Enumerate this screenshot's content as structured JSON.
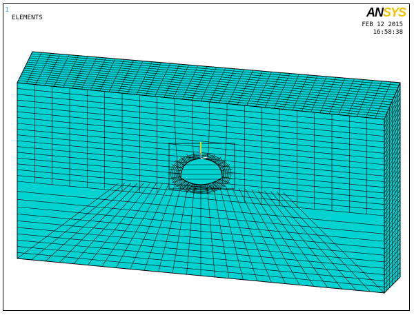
{
  "window": {
    "number": "1",
    "label": "ELEMENTS",
    "date": "FEB 12 2015",
    "time": "16:58:38"
  },
  "logo": {
    "part1": "AN",
    "part2": "SYS"
  },
  "colors": {
    "mesh_face": "#00d2d2",
    "mesh_line": "#000000",
    "logo_accent": "#f2c200",
    "triad_y": "#e8e000",
    "triad_z": "#3a7dff",
    "window_number": "#3aa5ff"
  },
  "mesh": {
    "front_columns": 21,
    "upper_rows": 17,
    "lower_rows": 11,
    "side_columns": 6,
    "top_rows": 15
  }
}
